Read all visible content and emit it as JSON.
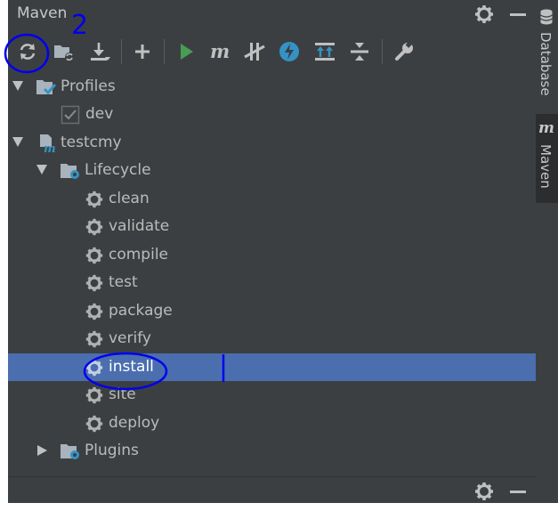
{
  "header": {
    "title": "Maven"
  },
  "toolbar": {
    "buttons": [
      "reload-icon",
      "add-project-icon",
      "download-icon",
      "plus-icon",
      "run-icon",
      "maven-goal-icon",
      "skip-tests-icon",
      "offline-icon",
      "show-dependencies-icon",
      "collapse-all-icon",
      "settings-wrench-icon"
    ]
  },
  "tree": {
    "profiles_label": "Profiles",
    "dev_label": "dev",
    "project_label": "testcmy",
    "lifecycle_label": "Lifecycle",
    "goals": [
      "clean",
      "validate",
      "compile",
      "test",
      "package",
      "verify",
      "install",
      "site",
      "deploy"
    ],
    "selected_goal": "install",
    "plugins_label": "Plugins"
  },
  "sidebar": {
    "tabs": [
      "Database",
      "Maven"
    ],
    "maven_icon_letter": "m"
  },
  "annotation": {
    "number": "2"
  },
  "colors": {
    "panel": "#3c3f41",
    "selection": "#4b6eaf",
    "text": "#bbbbbb",
    "run_green": "#499c54",
    "accent_blue": "#3592c4",
    "pen": "#0000ee"
  }
}
